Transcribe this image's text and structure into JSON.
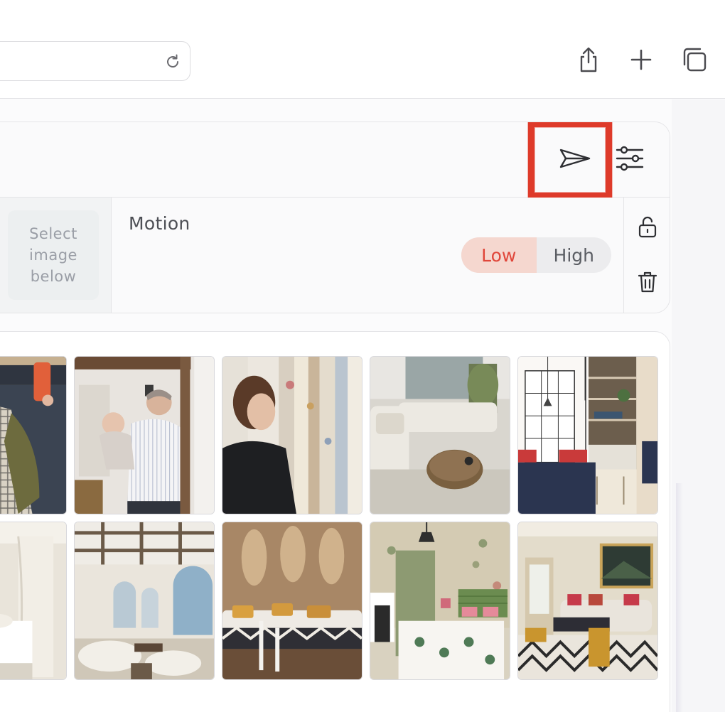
{
  "browser": {
    "toolbar_icons": [
      "reload-icon",
      "share-icon",
      "plus-icon",
      "tabs-icon"
    ]
  },
  "prompt_panel": {
    "send_icon": "paper-plane-icon",
    "settings_icon": "sliders-icon",
    "image_slot_text": "Select image below",
    "motion": {
      "label": "Motion",
      "options": [
        "Low",
        "High"
      ],
      "selected": "Low"
    },
    "side_icons": [
      "unlock-icon",
      "trash-icon"
    ]
  },
  "colors": {
    "accent_red": "#e0463a",
    "low_pill_bg": "#f5d7cf",
    "annotation_red": "#de3a2a"
  },
  "gallery": {
    "rows": [
      [
        "person-selfie-clothing-store",
        "woman-holding-baby-at-home",
        "woman-viewing-fabric-curtains",
        "living-room-sofa-coffee-table",
        "kitchen-sketch-rendering"
      ],
      [
        "white-bedroom-canopy",
        "arched-great-room",
        "living-room-wall-sconces",
        "bedroom-floral-wallpaper",
        "traditional-living-room"
      ]
    ]
  }
}
